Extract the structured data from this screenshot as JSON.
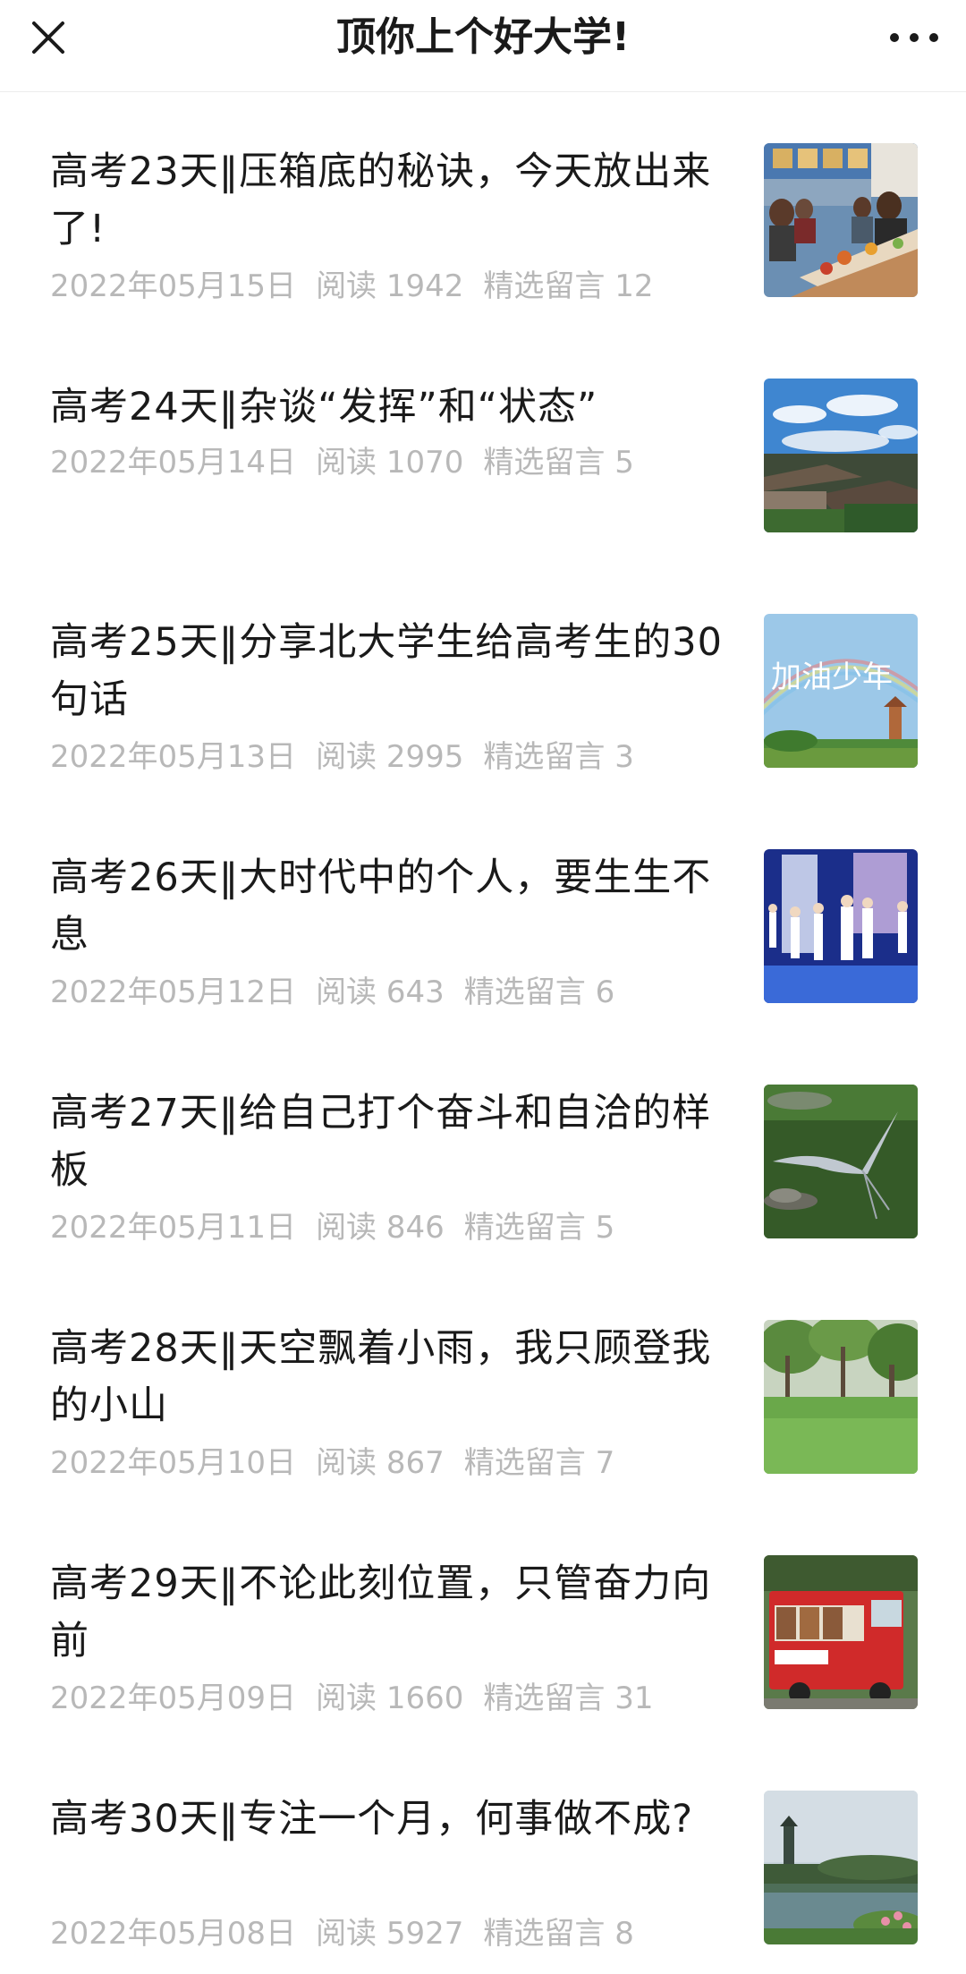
{
  "header": {
    "title": "顶你上个好大学!"
  },
  "icons": {
    "close": "close-icon",
    "more": "more-dots-icon"
  },
  "colors": {
    "title_text": "#1a1a1a",
    "meta_text": "#b8b8b8",
    "background": "#ffffff"
  },
  "articles": [
    {
      "title": "高考23天‖压箱底的秘诀，今天放出来了!",
      "date": "2022年05月15日",
      "reads_label": "阅读",
      "reads": "1942",
      "comments_label": "精选留言",
      "comments": "12",
      "thumb": "restaurant-dining-photo"
    },
    {
      "title": "高考24天‖杂谈“发挥”和“状态”",
      "date": "2022年05月14日",
      "reads_label": "阅读",
      "reads": "1070",
      "comments_label": "精选留言",
      "comments": "5",
      "thumb": "campus-rooftops-blue-sky-photo"
    },
    {
      "title": "高考25天‖分享北大学生给高考生的30句话",
      "date": "2022年05月13日",
      "reads_label": "阅读",
      "reads": "2995",
      "comments_label": "精选留言",
      "comments": "3",
      "thumb": "rainbow-pagoda-photo"
    },
    {
      "title": "高考26天‖大时代中的个人，要生生不息",
      "date": "2022年05月12日",
      "reads_label": "阅读",
      "reads": "643",
      "comments_label": "精选留言",
      "comments": "6",
      "thumb": "stage-performance-photo"
    },
    {
      "title": "高考27天‖给自己打个奋斗和自洽的样板",
      "date": "2022年05月11日",
      "reads_label": "阅读",
      "reads": "846",
      "comments_label": "精选留言",
      "comments": "5",
      "thumb": "heron-lake-photo"
    },
    {
      "title": "高考28天‖天空飘着小雨，我只顾登我的小山",
      "date": "2022年05月10日",
      "reads_label": "阅读",
      "reads": "867",
      "comments_label": "精选留言",
      "comments": "7",
      "thumb": "green-lawn-trees-photo"
    },
    {
      "title": "高考29天‖不论此刻位置，只管奋力向前",
      "date": "2022年05月09日",
      "reads_label": "阅读",
      "reads": "1660",
      "comments_label": "精选留言",
      "comments": "31",
      "thumb": "red-food-truck-photo"
    },
    {
      "title": "高考30天‖专注一个月，何事做不成?",
      "date": "2022年05月08日",
      "reads_label": "阅读",
      "reads": "5927",
      "comments_label": "精选留言",
      "comments": "8",
      "thumb": "lake-pagoda-photo"
    }
  ]
}
